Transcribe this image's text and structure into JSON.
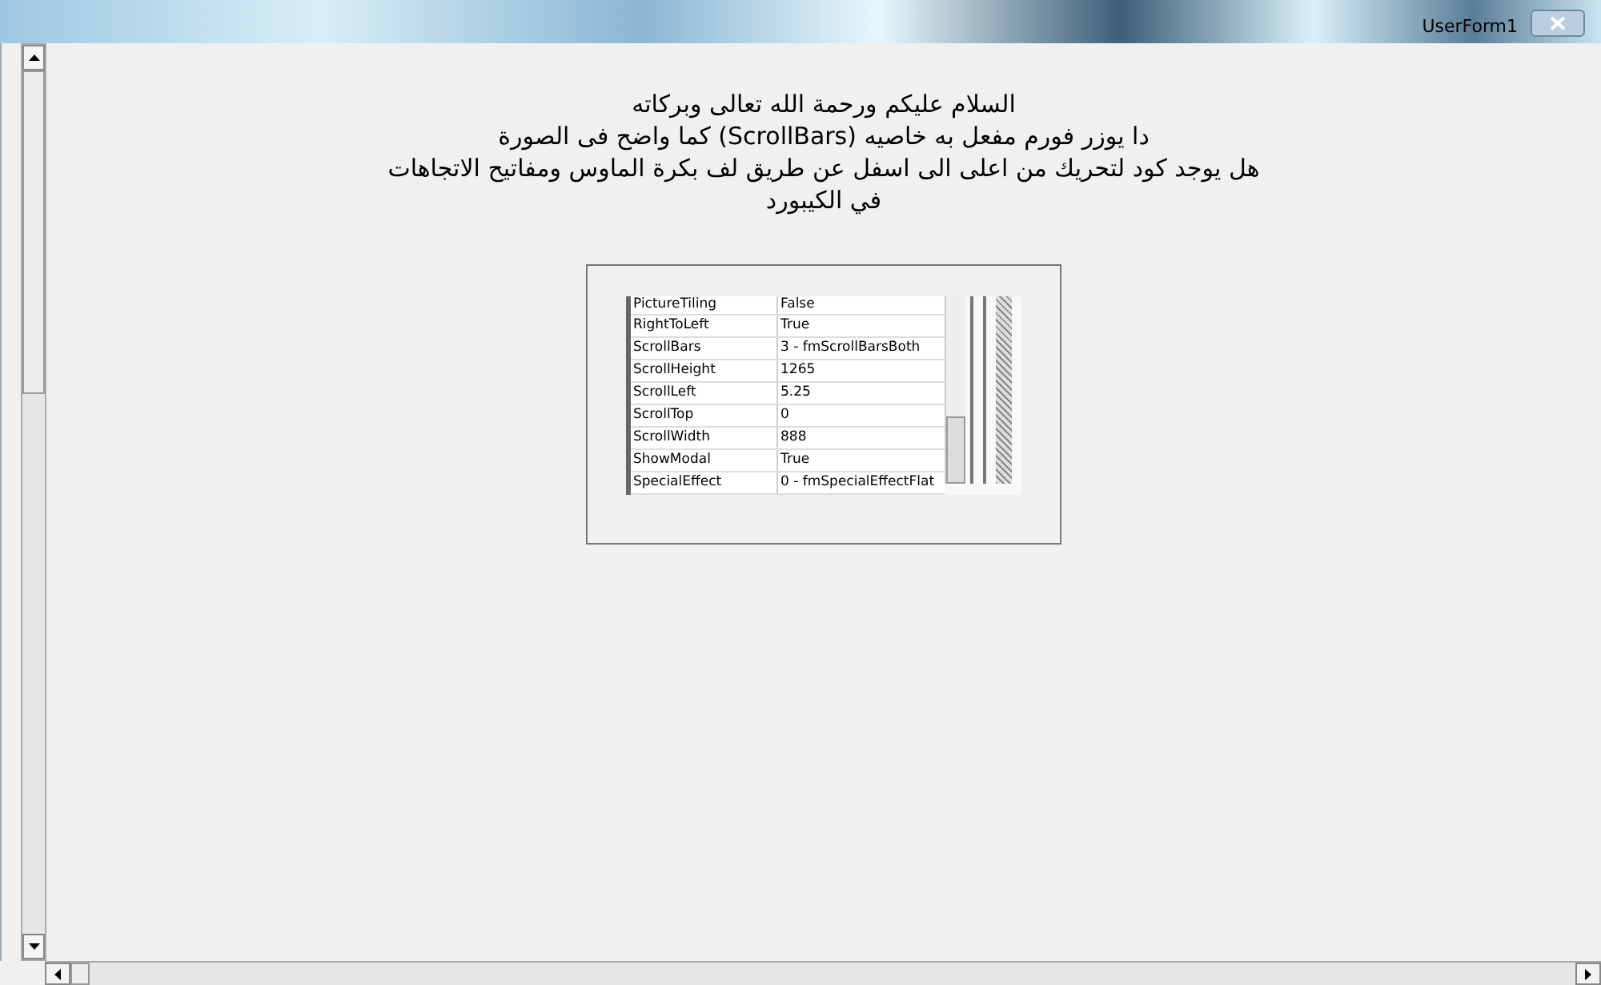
{
  "window": {
    "title": "UserForm1"
  },
  "message": [
    "السلام عليكم ورحمة الله تعالى وبركاته",
    "دا يوزر فورم مفعل به خاصيه (ScrollBars)  كما واضح فى الصورة",
    "هل يوجد كود لتحريك من اعلى الى اسفل عن طريق لف بكرة الماوس ومفاتيح الاتجاهات",
    "في الكيبورد"
  ],
  "properties": [
    {
      "name": "PictureTiling",
      "value": "False"
    },
    {
      "name": "RightToLeft",
      "value": "True"
    },
    {
      "name": "ScrollBars",
      "value": "3 - fmScrollBarsBoth"
    },
    {
      "name": "ScrollHeight",
      "value": "1265"
    },
    {
      "name": "ScrollLeft",
      "value": "5.25"
    },
    {
      "name": "ScrollTop",
      "value": "0"
    },
    {
      "name": "ScrollWidth",
      "value": "888"
    },
    {
      "name": "ShowModal",
      "value": "True"
    },
    {
      "name": "SpecialEffect",
      "value": "0 - fmSpecialEffectFlat"
    }
  ]
}
